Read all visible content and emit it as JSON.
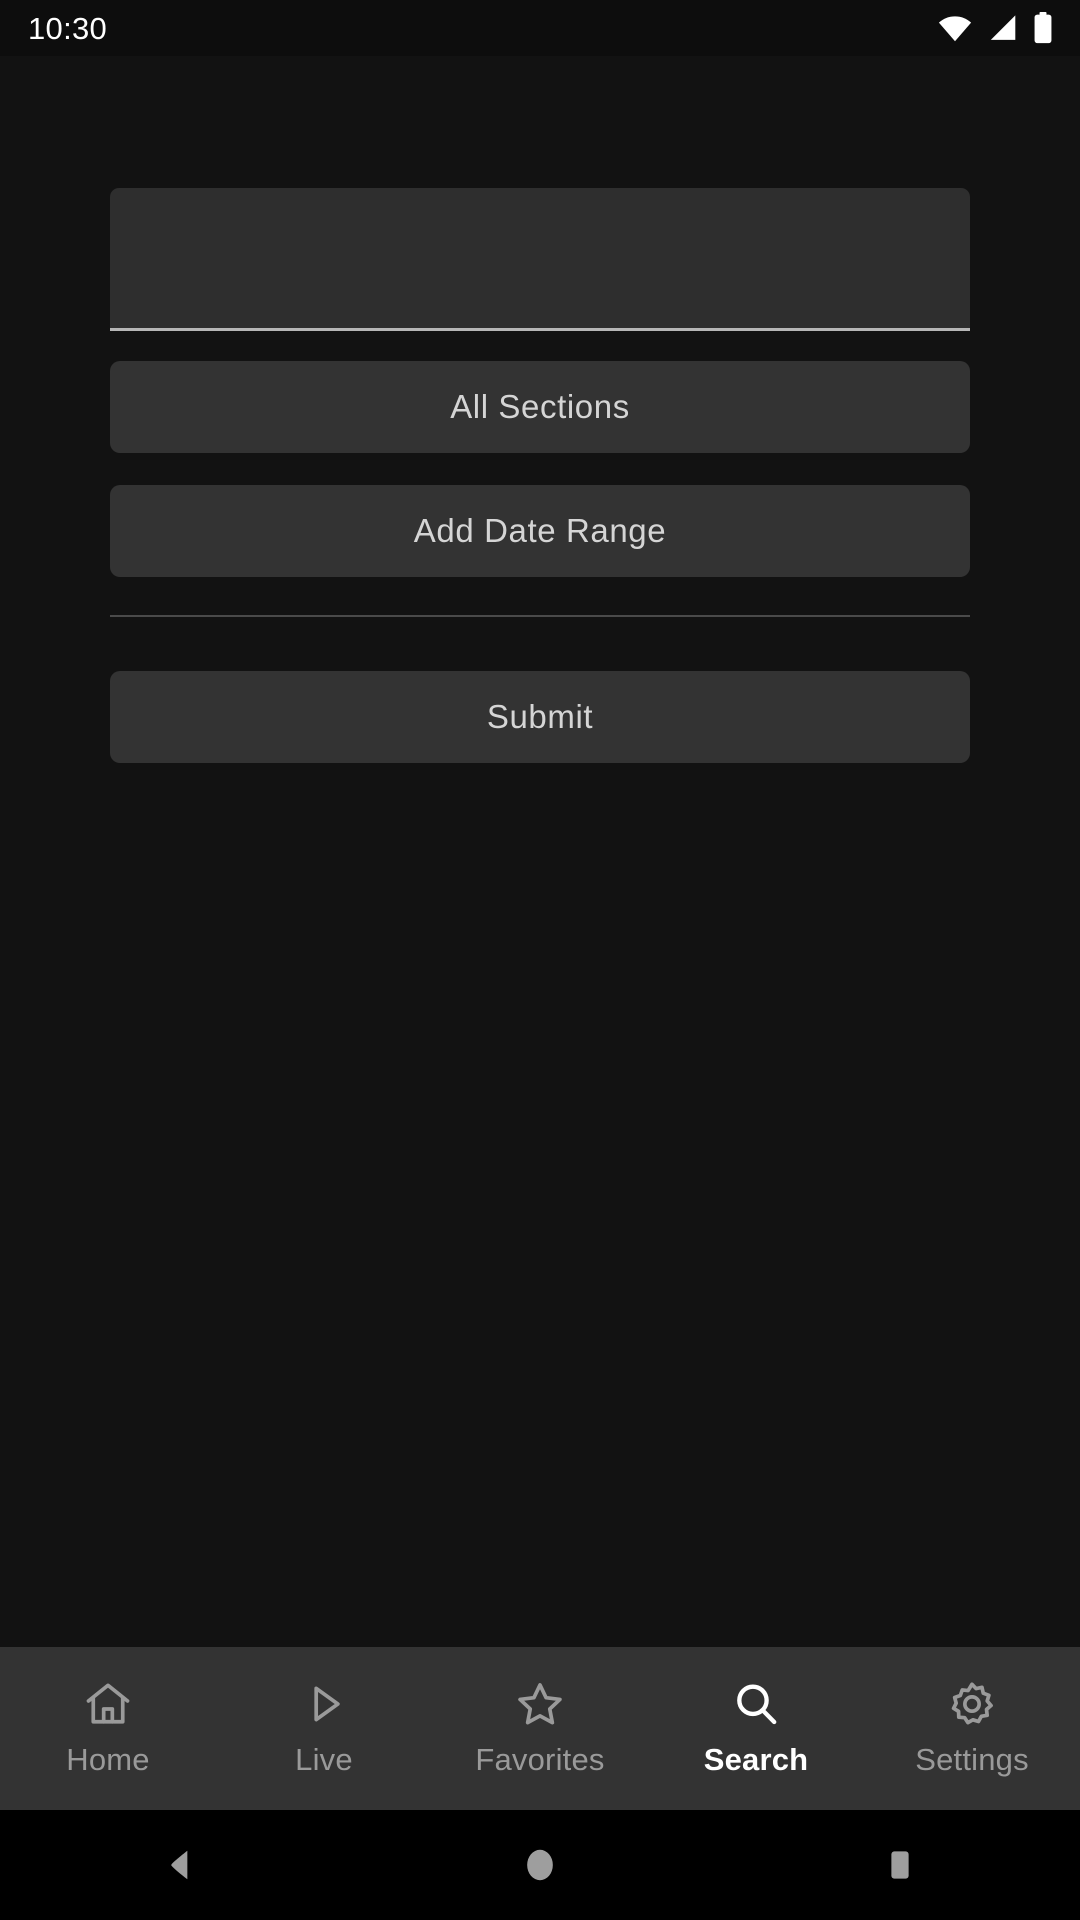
{
  "status_bar": {
    "time": "10:30",
    "icons": [
      "wifi-icon",
      "cellular-signal-icon",
      "battery-icon"
    ]
  },
  "screen": {
    "background_color": "#121212",
    "surface_color": "#333333",
    "field_color": "#2e2e2e",
    "text_color": "#d5d5d5",
    "active_color": "#ffffff",
    "inactive_color": "#9a9a9a"
  },
  "search_form": {
    "query_input": {
      "value": "",
      "placeholder": ""
    },
    "sections_button": "All Sections",
    "date_range_button": "Add Date Range",
    "submit_button": "Submit"
  },
  "bottom_nav": {
    "active_index": 3,
    "items": [
      {
        "label": "Home",
        "icon": "home-icon"
      },
      {
        "label": "Live",
        "icon": "play-icon"
      },
      {
        "label": "Favorites",
        "icon": "star-icon"
      },
      {
        "label": "Search",
        "icon": "search-icon"
      },
      {
        "label": "Settings",
        "icon": "gear-icon"
      }
    ]
  },
  "system_nav": {
    "back": "back-button",
    "home": "home-button",
    "recents": "recents-button"
  }
}
